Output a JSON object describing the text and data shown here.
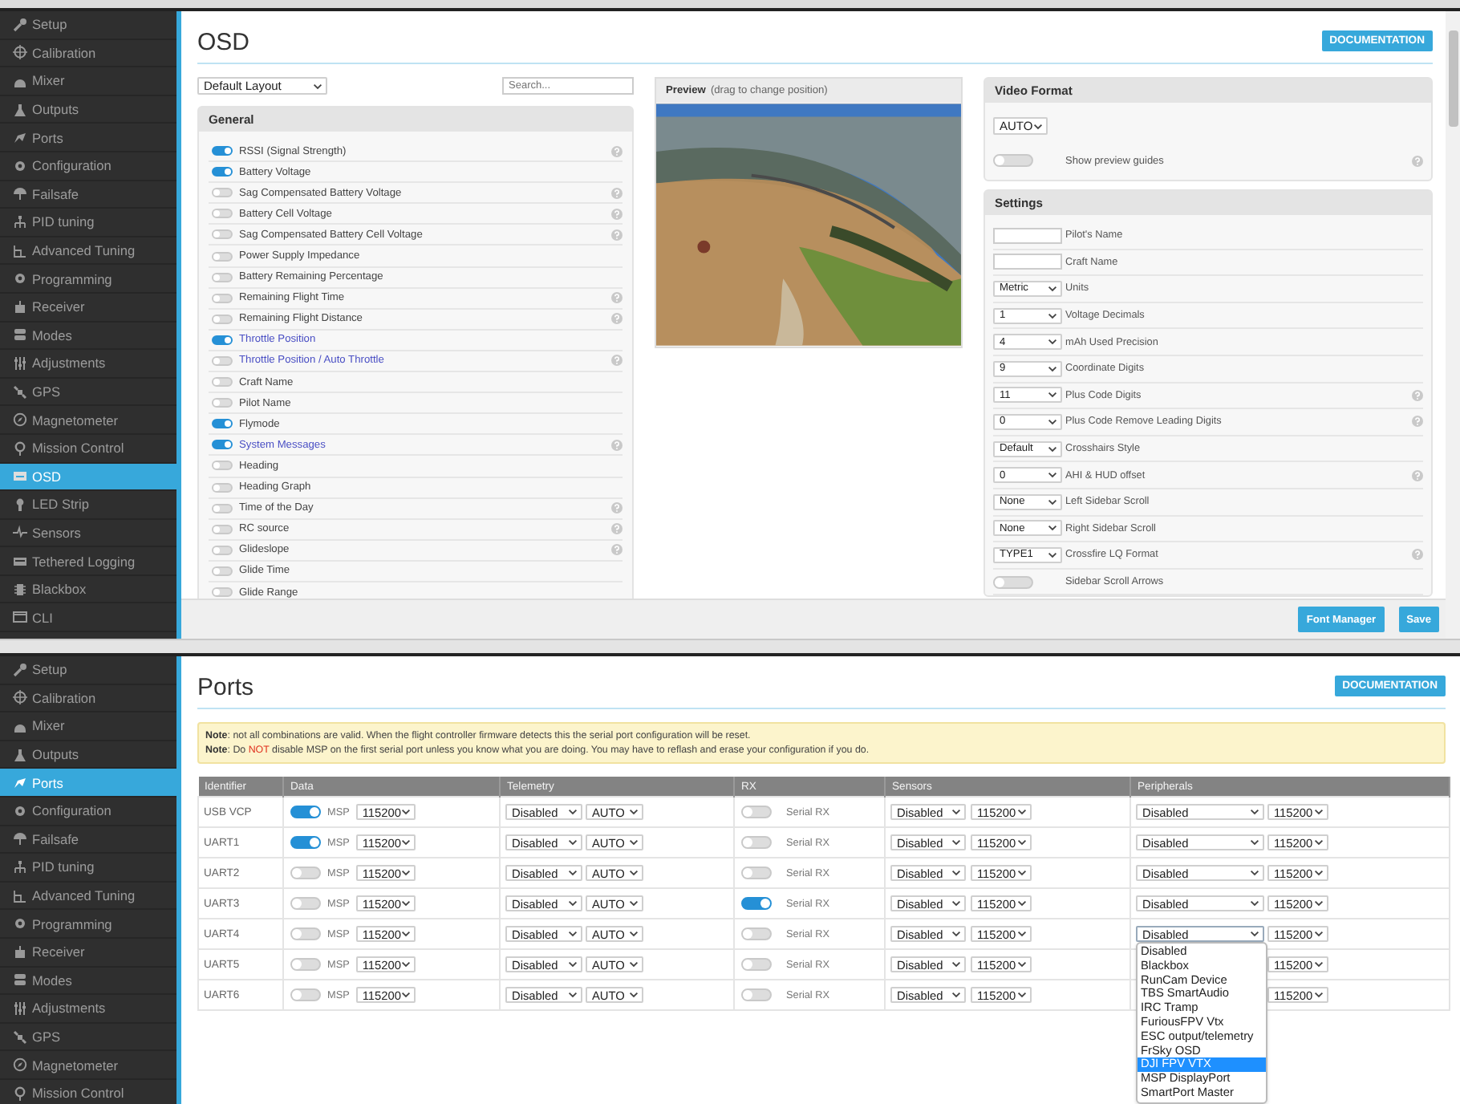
{
  "osd_screen": {
    "sidebar": {
      "items": [
        {
          "label": "Setup",
          "selected": false
        },
        {
          "label": "Calibration",
          "selected": false
        },
        {
          "label": "Mixer",
          "selected": false
        },
        {
          "label": "Outputs",
          "selected": false
        },
        {
          "label": "Ports",
          "selected": false
        },
        {
          "label": "Configuration",
          "selected": false
        },
        {
          "label": "Failsafe",
          "selected": false
        },
        {
          "label": "PID tuning",
          "selected": false
        },
        {
          "label": "Advanced Tuning",
          "selected": false
        },
        {
          "label": "Programming",
          "selected": false
        },
        {
          "label": "Receiver",
          "selected": false
        },
        {
          "label": "Modes",
          "selected": false
        },
        {
          "label": "Adjustments",
          "selected": false
        },
        {
          "label": "GPS",
          "selected": false
        },
        {
          "label": "Magnetometer",
          "selected": false
        },
        {
          "label": "Mission Control",
          "selected": false
        },
        {
          "label": "OSD",
          "selected": true
        },
        {
          "label": "LED Strip",
          "selected": false
        },
        {
          "label": "Sensors",
          "selected": false
        },
        {
          "label": "Tethered Logging",
          "selected": false
        },
        {
          "label": "Blackbox",
          "selected": false
        },
        {
          "label": "CLI",
          "selected": false
        }
      ]
    },
    "title": "OSD",
    "documentation_button": "DOCUMENTATION",
    "layout_select": {
      "value": "Default Layout"
    },
    "search": {
      "placeholder": "Search..."
    },
    "general": {
      "title": "General",
      "items": [
        {
          "label": "RSSI (Signal Strength)",
          "on": true,
          "highlighted": false,
          "help": true
        },
        {
          "label": "Battery Voltage",
          "on": true,
          "highlighted": false,
          "help": false
        },
        {
          "label": "Sag Compensated Battery Voltage",
          "on": false,
          "highlighted": false,
          "help": true
        },
        {
          "label": "Battery Cell Voltage",
          "on": false,
          "highlighted": false,
          "help": true
        },
        {
          "label": "Sag Compensated Battery Cell Voltage",
          "on": false,
          "highlighted": false,
          "help": true
        },
        {
          "label": "Power Supply Impedance",
          "on": false,
          "highlighted": false,
          "help": false
        },
        {
          "label": "Battery Remaining Percentage",
          "on": false,
          "highlighted": false,
          "help": false
        },
        {
          "label": "Remaining Flight Time",
          "on": false,
          "highlighted": false,
          "help": true
        },
        {
          "label": "Remaining Flight Distance",
          "on": false,
          "highlighted": false,
          "help": true
        },
        {
          "label": "Throttle Position",
          "on": true,
          "highlighted": true,
          "help": false
        },
        {
          "label": "Throttle Position / Auto Throttle",
          "on": false,
          "highlighted": true,
          "help": true
        },
        {
          "label": "Craft Name",
          "on": false,
          "highlighted": false,
          "help": false
        },
        {
          "label": "Pilot Name",
          "on": false,
          "highlighted": false,
          "help": false
        },
        {
          "label": "Flymode",
          "on": true,
          "highlighted": false,
          "help": false
        },
        {
          "label": "System Messages",
          "on": true,
          "highlighted": true,
          "help": true
        },
        {
          "label": "Heading",
          "on": false,
          "highlighted": false,
          "help": false
        },
        {
          "label": "Heading Graph",
          "on": false,
          "highlighted": false,
          "help": false
        },
        {
          "label": "Time of the Day",
          "on": false,
          "highlighted": false,
          "help": true
        },
        {
          "label": "RC source",
          "on": false,
          "highlighted": false,
          "help": true
        },
        {
          "label": "Glideslope",
          "on": false,
          "highlighted": false,
          "help": true
        },
        {
          "label": "Glide Time",
          "on": false,
          "highlighted": false,
          "help": false
        },
        {
          "label": "Glide Range",
          "on": false,
          "highlighted": false,
          "help": false
        }
      ]
    },
    "preview": {
      "title": "Preview",
      "hint": "(drag to change position)",
      "kind": "picture"
    },
    "video_format": {
      "title": "Video Format",
      "value": "AUTO",
      "guides": {
        "label": "Show preview guides",
        "on": false,
        "help": true
      }
    },
    "settings": {
      "title": "Settings",
      "items": [
        {
          "kind": "text",
          "label": "Pilot's Name",
          "help": false
        },
        {
          "kind": "text",
          "label": "Craft Name",
          "help": false
        },
        {
          "kind": "select",
          "value": "Metric",
          "label": "Units",
          "help": false
        },
        {
          "kind": "select",
          "value": "1",
          "label": "Voltage Decimals",
          "help": false
        },
        {
          "kind": "select",
          "value": "4",
          "label": "mAh Used Precision",
          "help": false
        },
        {
          "kind": "select",
          "value": "9",
          "label": "Coordinate Digits",
          "help": false
        },
        {
          "kind": "select",
          "value": "11",
          "label": "Plus Code Digits",
          "help": true
        },
        {
          "kind": "select",
          "value": "0",
          "label": "Plus Code Remove Leading Digits",
          "help": true
        },
        {
          "kind": "select",
          "value": "Default",
          "label": "Crosshairs Style",
          "help": false
        },
        {
          "kind": "select",
          "value": "0",
          "label": "AHI & HUD offset",
          "help": true
        },
        {
          "kind": "select",
          "value": "None",
          "label": "Left Sidebar Scroll",
          "help": false
        },
        {
          "kind": "select",
          "value": "None",
          "label": "Right Sidebar Scroll",
          "help": false
        },
        {
          "kind": "select",
          "value": "TYPE1",
          "label": "Crossfire LQ Format",
          "help": true
        },
        {
          "kind": "toggle",
          "on": false,
          "label": "Sidebar Scroll Arrows",
          "help": false
        }
      ]
    },
    "footer_buttons": [
      "Font Manager",
      "Save"
    ]
  },
  "ports_screen": {
    "sidebar": {
      "items": [
        {
          "label": "Setup",
          "selected": false
        },
        {
          "label": "Calibration",
          "selected": false
        },
        {
          "label": "Mixer",
          "selected": false
        },
        {
          "label": "Outputs",
          "selected": false
        },
        {
          "label": "Ports",
          "selected": true
        },
        {
          "label": "Configuration",
          "selected": false
        },
        {
          "label": "Failsafe",
          "selected": false
        },
        {
          "label": "PID tuning",
          "selected": false
        },
        {
          "label": "Advanced Tuning",
          "selected": false
        },
        {
          "label": "Programming",
          "selected": false
        },
        {
          "label": "Receiver",
          "selected": false
        },
        {
          "label": "Modes",
          "selected": false
        },
        {
          "label": "Adjustments",
          "selected": false
        },
        {
          "label": "GPS",
          "selected": false
        },
        {
          "label": "Magnetometer",
          "selected": false
        },
        {
          "label": "Mission Control",
          "selected": false
        }
      ]
    },
    "title": "Ports",
    "documentation_button": "DOCUMENTATION",
    "notes": [
      {
        "before": "**Note**: not all combinations are valid. When the flight controller firmware detects this the serial port configuration will be reset."
      },
      {
        "before": "**Note**: Do ",
        "emphasis": "NOT",
        "after": " disable MSP on the first serial port unless you know what you are doing. You may have to reflash and erase your configuration if you do."
      }
    ],
    "table": {
      "columns": [
        "Identifier",
        "Data",
        "Telemetry",
        "RX",
        "Sensors",
        "Peripherals"
      ],
      "rows": [
        {
          "identifier": "USB VCP",
          "msp_on": true,
          "msp_label": "MSP",
          "msp_baud": "115200",
          "telemetry": "Disabled",
          "telemetry_baud": "AUTO",
          "rx_on": false,
          "rx_label": "Serial RX",
          "sensor": "Disabled",
          "sensor_baud": "115200",
          "peripheral": "Disabled",
          "peripheral_baud": "115200"
        },
        {
          "identifier": "UART1",
          "msp_on": true,
          "msp_label": "MSP",
          "msp_baud": "115200",
          "telemetry": "Disabled",
          "telemetry_baud": "AUTO",
          "rx_on": false,
          "rx_label": "Serial RX",
          "sensor": "Disabled",
          "sensor_baud": "115200",
          "peripheral": "Disabled",
          "peripheral_baud": "115200"
        },
        {
          "identifier": "UART2",
          "msp_on": false,
          "msp_label": "MSP",
          "msp_baud": "115200",
          "telemetry": "Disabled",
          "telemetry_baud": "AUTO",
          "rx_on": false,
          "rx_label": "Serial RX",
          "sensor": "Disabled",
          "sensor_baud": "115200",
          "peripheral": "Disabled",
          "peripheral_baud": "115200"
        },
        {
          "identifier": "UART3",
          "msp_on": false,
          "msp_label": "MSP",
          "msp_baud": "115200",
          "telemetry": "Disabled",
          "telemetry_baud": "AUTO",
          "rx_on": true,
          "rx_label": "Serial RX",
          "sensor": "Disabled",
          "sensor_baud": "115200",
          "peripheral": "Disabled",
          "peripheral_baud": "115200"
        },
        {
          "identifier": "UART4",
          "msp_on": false,
          "msp_label": "MSP",
          "msp_baud": "115200",
          "telemetry": "Disabled",
          "telemetry_baud": "AUTO",
          "rx_on": false,
          "rx_label": "Serial RX",
          "sensor": "Disabled",
          "sensor_baud": "115200",
          "peripheral": "Disabled",
          "peripheral_baud": "115200",
          "dropdown_open": true
        },
        {
          "identifier": "UART5",
          "msp_on": false,
          "msp_label": "MSP",
          "msp_baud": "115200",
          "telemetry": "Disabled",
          "telemetry_baud": "AUTO",
          "rx_on": false,
          "rx_label": "Serial RX",
          "sensor": "Disabled",
          "sensor_baud": "115200",
          "peripheral_baud": "115200"
        },
        {
          "identifier": "UART6",
          "msp_on": false,
          "msp_label": "MSP",
          "msp_baud": "115200",
          "telemetry": "Disabled",
          "telemetry_baud": "AUTO",
          "rx_on": false,
          "rx_label": "Serial RX",
          "sensor": "Disabled",
          "sensor_baud": "115200",
          "peripheral_baud": "115200"
        }
      ]
    },
    "dropdown": {
      "options": [
        {
          "label": "Disabled",
          "selected": false
        },
        {
          "label": "Blackbox",
          "selected": false
        },
        {
          "label": "RunCam Device",
          "selected": false
        },
        {
          "label": "TBS SmartAudio",
          "selected": false
        },
        {
          "label": "IRC Tramp",
          "selected": false
        },
        {
          "label": "FuriousFPV Vtx",
          "selected": false
        },
        {
          "label": "ESC output/telemetry",
          "selected": false
        },
        {
          "label": "FrSky OSD",
          "selected": false
        },
        {
          "label": "DJI FPV VTX",
          "selected": true
        },
        {
          "label": "MSP DisplayPort",
          "selected": false
        },
        {
          "label": "SmartPort Master",
          "selected": false
        }
      ]
    }
  }
}
